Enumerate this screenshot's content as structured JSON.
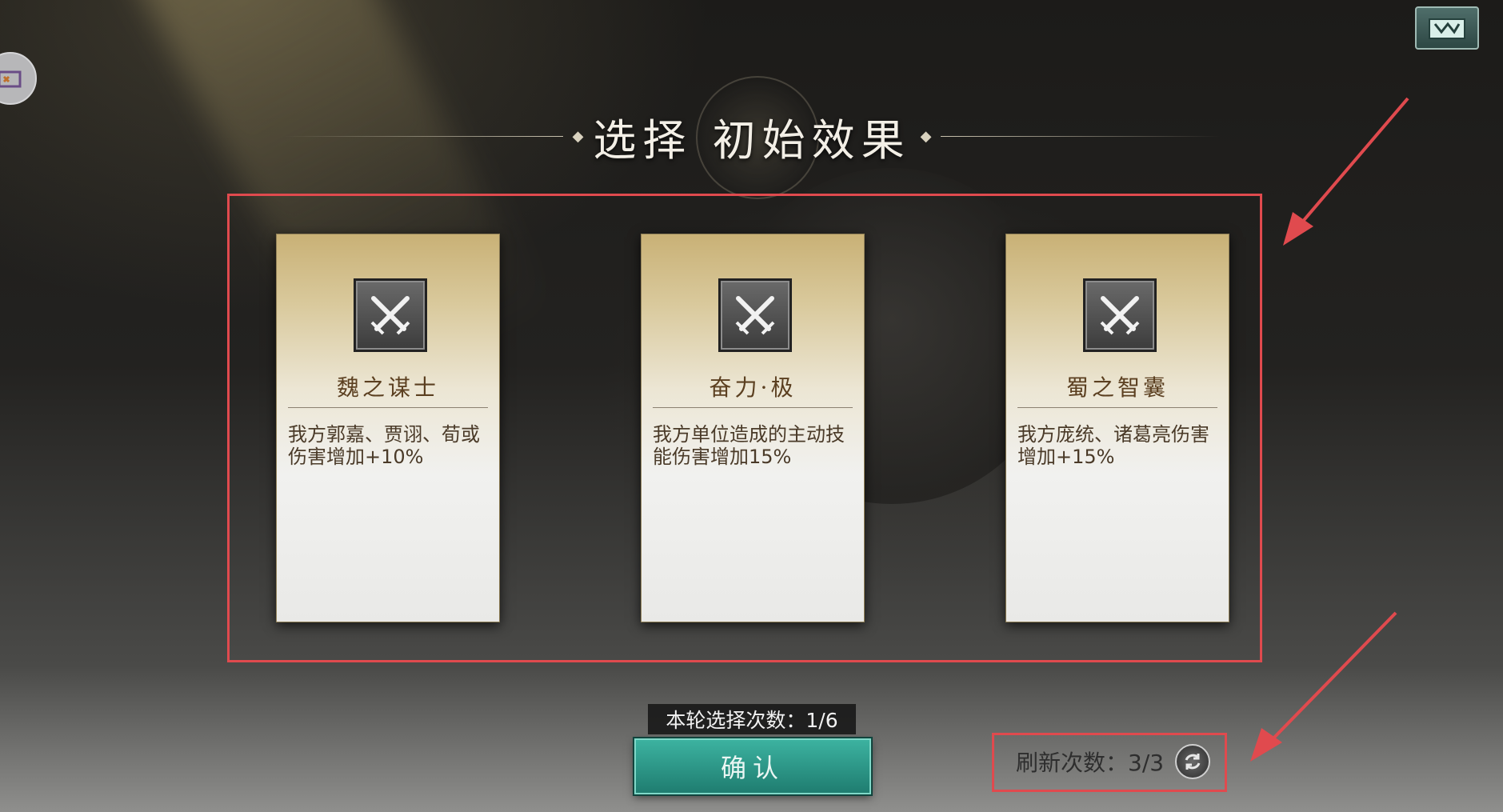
{
  "title": "选择 初始效果",
  "cards": [
    {
      "name": "魏之谋士",
      "desc": "我方郭嘉、贾诩、荀或伤害增加+10%",
      "icon": "crossed-swords-icon"
    },
    {
      "name": "奋力·极",
      "desc": "我方单位造成的主动技能伤害增加15%",
      "icon": "crossed-swords-icon"
    },
    {
      "name": "蜀之智囊",
      "desc": "我方庞统、诸葛亮伤害增加+15%",
      "icon": "crossed-swords-icon"
    }
  ],
  "selection_counter": "本轮选择次数：1/6",
  "confirm_label": "确认",
  "refresh_label": "刷新次数：3/3",
  "colors": {
    "annotation": "#e04a4e",
    "confirm": "#2a9a8a",
    "card_title": "#5b3f20"
  }
}
